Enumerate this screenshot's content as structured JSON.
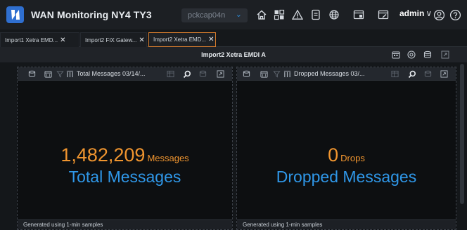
{
  "app": {
    "title": "WAN Monitoring NY4 TY3",
    "host_select": "pckcap04n",
    "user": "admin",
    "user_chevron": "∨"
  },
  "topbar_icons": [
    "home-icon",
    "dashboard-grid-icon",
    "alert-warning-icon",
    "report-icon",
    "network-globe-icon",
    "window-panel-icon",
    "window-edit-icon",
    "account-circle-icon",
    "help-icon"
  ],
  "tabs": [
    {
      "label": "Import1 Xetra EMD...",
      "close": "✕",
      "active": false
    },
    {
      "label": "Import2 FIX Gatew...",
      "close": "✕",
      "active": false
    },
    {
      "label": "Import2 Xetra EMD...",
      "close": "✕",
      "active": true
    }
  ],
  "header": {
    "title": "Import2 Xetra EMDI A"
  },
  "panels": [
    {
      "title": "Total Messages 03/14/...",
      "value": "1,482,209",
      "unit": "Messages",
      "label": "Total Messages",
      "footer": "Generated using 1-min samples"
    },
    {
      "title": "Dropped Messages 03/...",
      "value": "0",
      "unit": "Drops",
      "label": "Dropped Messages",
      "footer": "Generated using 1-min samples"
    }
  ],
  "colors": {
    "accent_orange": "#f0952f",
    "accent_blue": "#2f97e8",
    "active_tab_border": "#d47b2d",
    "background": "#0d0f11"
  }
}
